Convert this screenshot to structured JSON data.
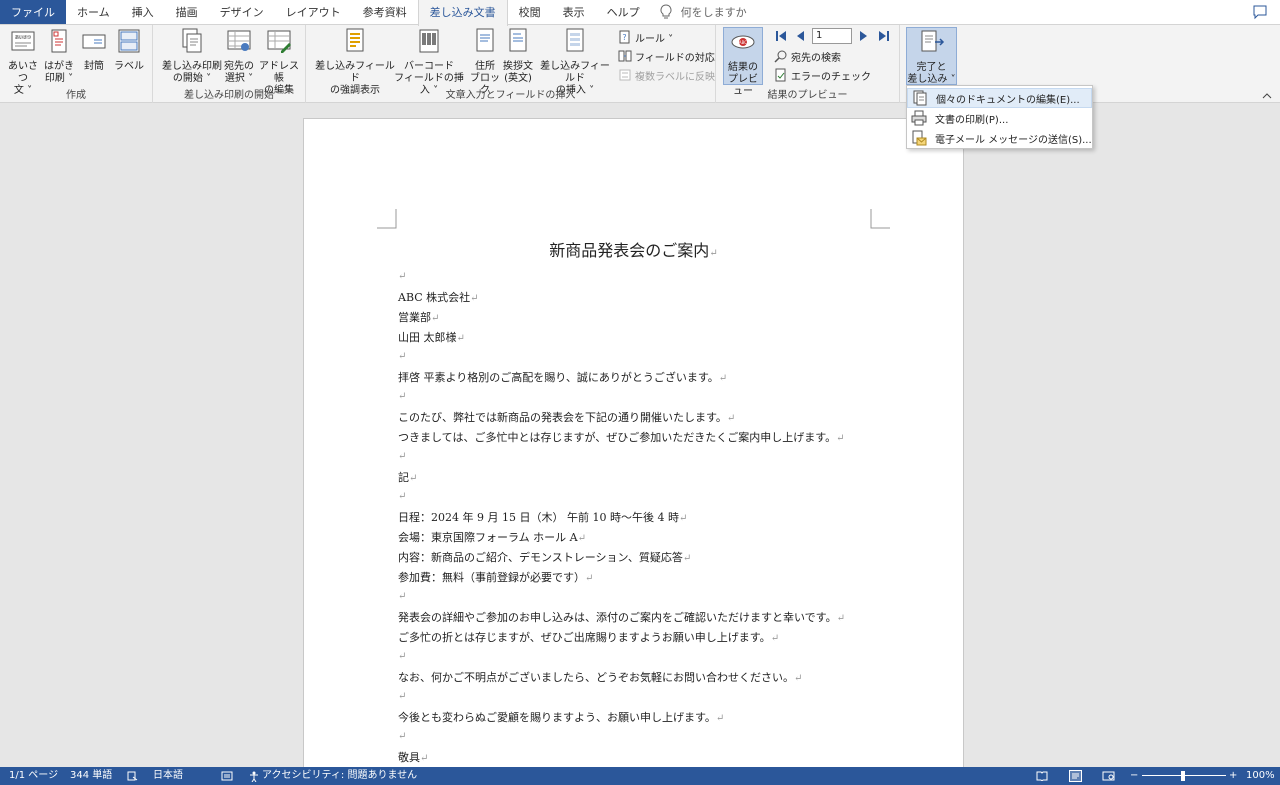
{
  "tabs": [
    "ファイル",
    "ホーム",
    "挿入",
    "描画",
    "デザイン",
    "レイアウト",
    "参考資料",
    "差し込み文書",
    "校閲",
    "表示",
    "ヘルプ"
  ],
  "tell_me": "何をしますか",
  "ribbon": {
    "groups": {
      "create": "作成",
      "start": "差し込み印刷の開始",
      "insert": "文章入力とフィールドの挿入",
      "preview": "結果のプレビュー"
    },
    "buttons": {
      "greeting": "あいさつ\n文 ˅",
      "postcard": "はがき\n印刷 ˅",
      "envelope": "封筒",
      "label": "ラベル",
      "start_merge": "差し込み印刷\nの開始 ˅",
      "select_recipients": "宛先の\n選択 ˅",
      "edit_list": "アドレス帳\nの編集",
      "highlight_fields": "差し込みフィールド\nの強調表示",
      "barcode": "バーコード\nフィールドの挿入 ˅",
      "address_block": "住所\nブロック",
      "greeting_line": "挨拶文\n(英文)",
      "insert_field": "差し込みフィールド\nの挿入 ˅",
      "rules": "ルール ˅",
      "match_fields": "フィールドの対応",
      "update_labels": "複数ラベルに反映",
      "preview_results": "結果の\nプレビュー",
      "find_recipient": "宛先の検索",
      "check_errors": "エラーのチェック",
      "finish_merge": "完了と\n差し込み ˅"
    },
    "record_number": "1"
  },
  "dropdown": [
    "個々のドキュメントの編集(E)...",
    "文書の印刷(P)...",
    "電子メール メッセージの送信(S)..."
  ],
  "document": {
    "title": "新商品発表会のご案内",
    "lines": [
      "",
      "ABC 株式会社",
      "営業部",
      "山田 太郎様",
      "",
      "拝啓 平素より格別のご高配を賜り、誠にありがとうございます。",
      "",
      "このたび、弊社では新商品の発表会を下記の通り開催いたします。",
      "つきましては、ご多忙中とは存じますが、ぜひご参加いただきたくご案内申し上げます。",
      "",
      "記",
      "",
      "日程：2024 年 9 月 15 日（木） 午前 10 時〜午後 4 時",
      "会場：東京国際フォーラム ホール A",
      "内容：新商品のご紹介、デモンストレーション、質疑応答",
      "参加費：無料（事前登録が必要です）",
      "",
      "発表会の詳細やご参加のお申し込みは、添付のご案内をご確認いただけますと幸いです。",
      "ご多忙の折とは存じますが、ぜひご出席賜りますようお願い申し上げます。",
      "",
      "なお、何かご不明点がございましたら、どうぞお気軽にお問い合わせください。",
      "",
      "今後とも変わらぬご愛顧を賜りますよう、お願い申し上げます。",
      "",
      "敬具"
    ],
    "paragraph_mark": "↵"
  },
  "status": {
    "page": "1/1 ページ",
    "words": "344 単語",
    "language": "日本語",
    "accessibility": "アクセシビリティ: 問題ありません",
    "zoom": "100%",
    "zoom_minus": "−",
    "zoom_plus": "+"
  },
  "colors": {
    "accent": "#2b579a"
  }
}
